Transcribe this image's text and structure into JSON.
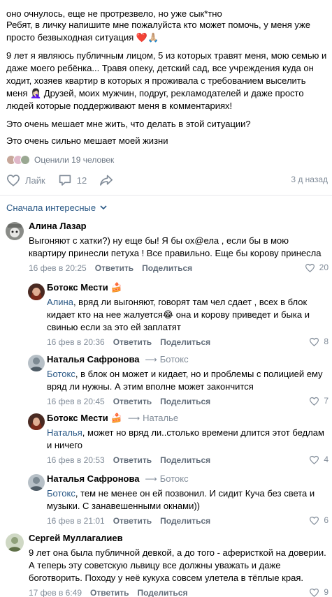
{
  "post": {
    "paragraphs": [
      "оно очнулось, еще не протрезвело, но уже сык*тно",
      "Ребят, в личку напишите мне пожалуйста кто может помочь, у меня уже просто безвыходная ситуация ❤️🙏🏼",
      "9 лет я являюсь публичным лицом, 5 из которых травят меня, мою семью и даже моего ребёнка... Травя опеку, детский сад, все учреждения куда он ходит, хозяев квартир в которых я проживала с требованием выселить меня 🤦🏻‍♀️ Друзей, моих мужчин, подруг, рекламодателей и даже просто людей которые поддерживают меня в комментариях!",
      "Это очень мешает мне жить, что делать в этой ситуации?",
      "Это очень сильно мешает моей жизни"
    ],
    "rated_label": "Оценили 19 человек",
    "like_label": "Лайк",
    "comments_count": "12",
    "date": "3 д назад"
  },
  "sort_label": "Сначала интересные",
  "actions": {
    "reply": "Ответить",
    "share": "Поделиться"
  },
  "comments": [
    {
      "name": "Алина Лазар",
      "text": "Выгоняют с хатки?) ну еще бы! Я бы ох@ела , если бы в мою квартиру принесли петуха ! Все правильно. Еще бы корову принесла",
      "time": "16 фев в 20:25",
      "likes": "20"
    },
    {
      "name": "Ботокс Мести",
      "mention": "Алина",
      "text": ", вряд ли выгоняют, говорят там чел сдает , всех в блок кидает кто на нее жалуется😂 она и корову приведет и быка и свинью если за это ей заплатят",
      "time": "16 фев в 20:36",
      "likes": "8"
    },
    {
      "name": "Наталья Сафронова",
      "reply_to": "Ботокс",
      "mention": "Ботокс",
      "text": ", в блок он может и кидает, но и проблемы с полицией ему вряд ли нужны. А этим вполне может закончится",
      "time": "16 фев в 20:45",
      "likes": "7"
    },
    {
      "name": "Ботокс Мести",
      "reply_to": "Наталье",
      "mention": "Наталья",
      "text": ", может но вряд ли..столько времени длится этот бедлам и ничего",
      "time": "16 фев в 20:53",
      "likes": "4"
    },
    {
      "name": "Наталья Сафронова",
      "reply_to": "Ботокс",
      "mention": "Ботокс",
      "text": ", тем не менее он ей позвонил. И сидит Куча без света и музыки. С занавешенными окнами))",
      "time": "16 фев в 21:01",
      "likes": "6"
    },
    {
      "name": "Сергей Муллагалиев",
      "text": "9 лет она была публичной девкой, а до того - аферисткой на доверии. А теперь эту советскую львицу все должны уважать и даже боготворить. Походу у неё кукуха совсем улетела в тёплые края.",
      "time": "17 фев в 6:49",
      "likes": "9"
    }
  ],
  "colors": {
    "link": "#2a5885",
    "secondary": "#818c99",
    "separator": "#e7e8ec",
    "heart": "#e64646"
  }
}
